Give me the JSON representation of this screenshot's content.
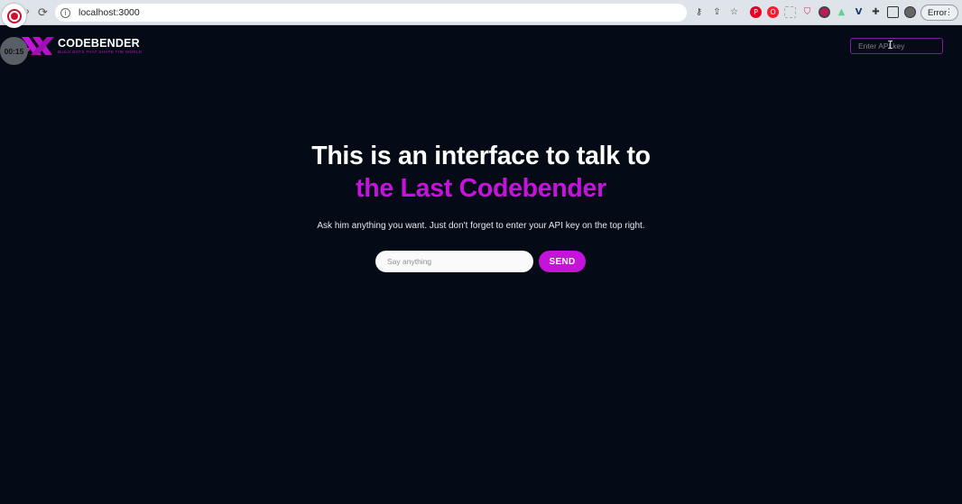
{
  "browser": {
    "url": "localhost:3000",
    "profile_button_label": "Error",
    "extensions": [
      "key-icon",
      "share-icon",
      "star-icon",
      "pinterest-icon",
      "opera-icon",
      "extension-box-icon",
      "shield-icon",
      "extension-red-icon",
      "extension-green-icon",
      "vee-icon",
      "puzzle-icon",
      "sidebar-icon",
      "avatar-icon"
    ]
  },
  "recording": {
    "timer": "00:15"
  },
  "header": {
    "logo_name": "CODEBENDER",
    "logo_tagline": "BUILD BOTS THAT SHAPE THE WORLD",
    "api_key_placeholder": "Enter API key"
  },
  "hero": {
    "title_line1": "This is an interface to talk to",
    "title_line2": "the Last Codebender",
    "subtitle": "Ask him anything you want. Just don't forget to enter your API key on the top right.",
    "input_placeholder": "Say anything",
    "send_label": "SEND"
  },
  "colors": {
    "background": "#040b16",
    "accent": "#c613d9",
    "input_border": "#7b1fa2"
  }
}
